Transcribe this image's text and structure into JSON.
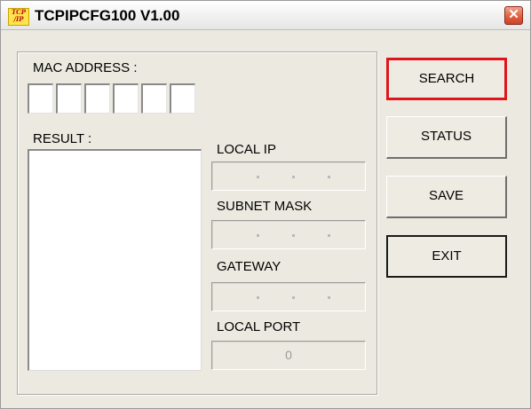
{
  "window": {
    "title": "TCPIPCFG100 V1.00",
    "icon_text": [
      "TCP",
      "/IP"
    ],
    "close_glyph": "✕",
    "colors": {
      "close_button": "#e0613f",
      "highlight_border": "#e0151c"
    }
  },
  "mac": {
    "label": "MAC ADDRESS :",
    "octets": [
      "",
      "",
      "",
      "",
      "",
      ""
    ]
  },
  "result": {
    "label": "RESULT :",
    "content": ""
  },
  "fields": {
    "local_ip": {
      "label": "LOCAL IP",
      "value": ""
    },
    "subnet_mask": {
      "label": "SUBNET MASK",
      "value": ""
    },
    "gateway": {
      "label": "GATEWAY",
      "value": ""
    },
    "local_port": {
      "label": "LOCAL PORT",
      "value": "0"
    }
  },
  "buttons": {
    "search": "SEARCH",
    "status": "STATUS",
    "save": "SAVE",
    "exit": "EXIT"
  }
}
